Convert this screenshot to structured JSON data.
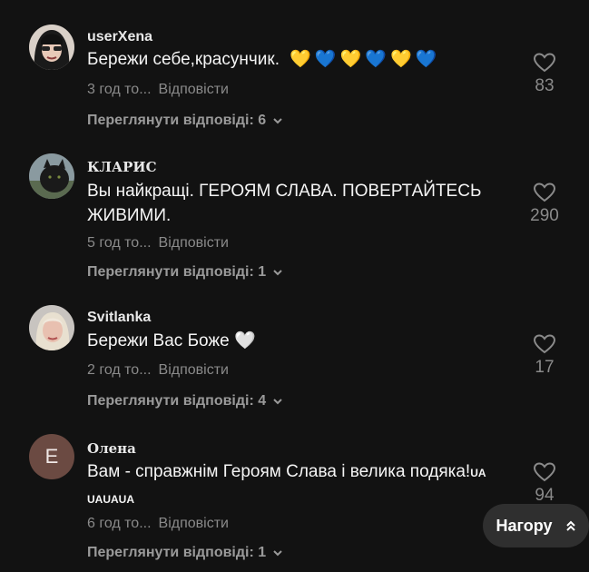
{
  "comments": [
    {
      "username": "userXena",
      "text": "Бережи себе,красунчик.",
      "hearts": [
        "💛",
        "💙",
        "💛",
        "💙",
        "💛",
        "💙"
      ],
      "time": "3 год то...",
      "reply_label": "Відповісти",
      "view_replies": "Переглянути відповіді: 6",
      "likes": "83"
    },
    {
      "username": "КЛАРИС",
      "text": "Вы найкращі. ГЕРОЯМ СЛАВА. ПОВЕРТАЙТЕСЬ ЖИВИМИ.",
      "time": "5 год то...",
      "reply_label": "Відповісти",
      "view_replies": "Переглянути відповіді: 1",
      "likes": "290"
    },
    {
      "username": "Svitlanka",
      "text": "Бережи Вас Боже 🤍",
      "time": "2 год то...",
      "reply_label": "Відповісти",
      "view_replies": "Переглянути відповіді: 4",
      "likes": "17"
    },
    {
      "username": "Олена",
      "avatar_letter": "E",
      "text": "Вам - справжнім Героям Слава і велика подяка!",
      "text_suffix": "UA",
      "text_line2": "UAUAUA",
      "time": "6 год то...",
      "reply_label": "Відповісти",
      "view_replies": "Переглянути відповіді: 1",
      "likes": "94"
    }
  ],
  "top_button": {
    "label": "Нагору",
    "icon": "double-chevron-up-icon"
  },
  "colors": {
    "background": "#121212",
    "muted": "#8a8a8a",
    "avatar_letter_bg": "#6b4a42",
    "yellow": "#ffd21f",
    "blue": "#1f6bff"
  }
}
